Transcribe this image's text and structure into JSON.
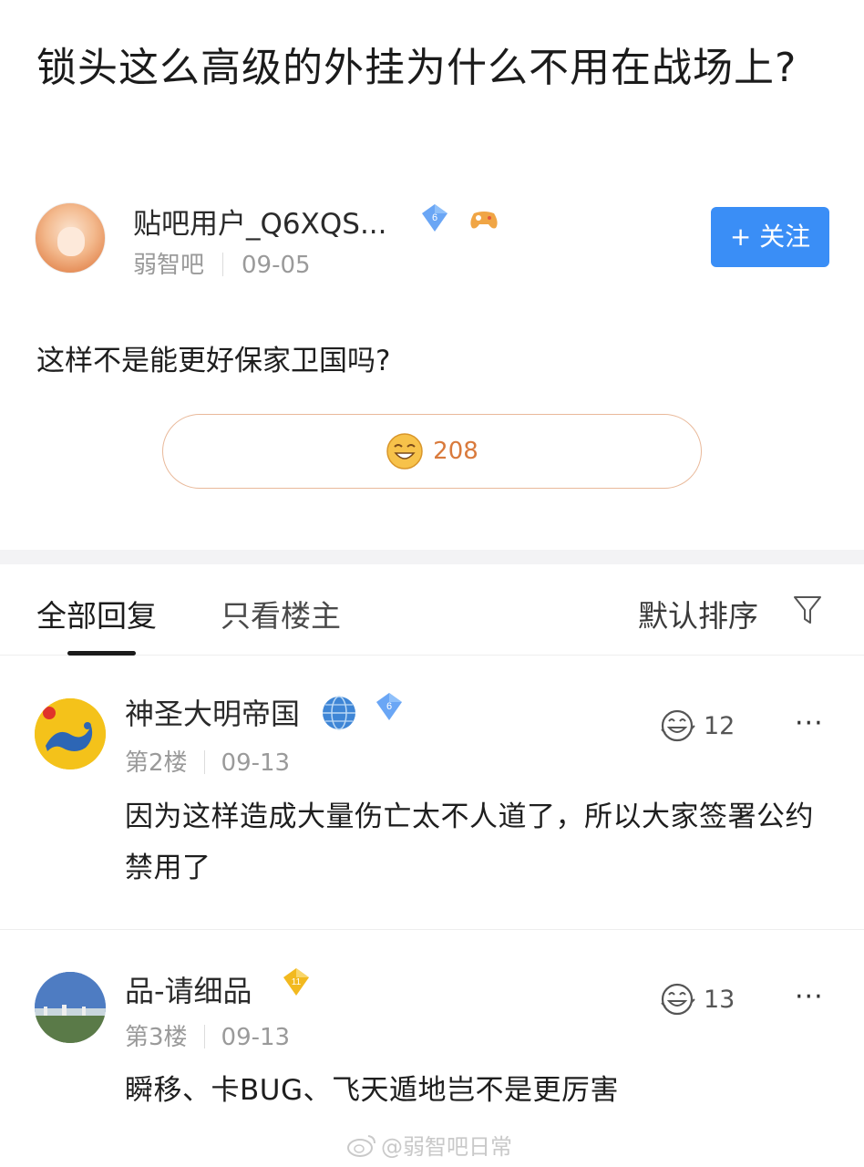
{
  "post": {
    "title": "锁头这么高级的外挂为什么不用在战场上?",
    "body": "这样不是能更好保家卫国吗?",
    "likes": "208"
  },
  "author": {
    "name": "贴吧用户_Q6XQS...",
    "level": "6",
    "forum": "弱智吧",
    "date": "09-05",
    "follow_label": "+ 关注"
  },
  "tabs": {
    "all": "全部回复",
    "op_only": "只看楼主",
    "sort": "默认排序"
  },
  "replies": [
    {
      "user": "神圣大明帝国",
      "level": "6",
      "floor": "第2楼",
      "date": "09-13",
      "likes": "12",
      "more": "···",
      "text": "因为这样造成大量伤亡太不人道了，所以大家签署公约禁用了"
    },
    {
      "user": "品-请细品",
      "level": "11",
      "floor": "第3楼",
      "date": "09-13",
      "likes": "13",
      "more": "···",
      "text": "瞬移、卡BUG、飞天遁地岂不是更厉害"
    }
  ],
  "watermark": "@弱智吧日常",
  "colors": {
    "accent_blue": "#3a8ef6",
    "like_orange": "#d97a3c",
    "level_blue": "#5b9bf0",
    "level_gold": "#f2b91f"
  },
  "icons": {
    "level_badge": "diamond-badge-icon",
    "game": "gamepad-icon",
    "laugh": "laughing-face-icon",
    "filter": "filter-funnel-icon",
    "globe": "globe-icon",
    "more": "more-dots-icon",
    "weibo": "weibo-logo-icon"
  }
}
